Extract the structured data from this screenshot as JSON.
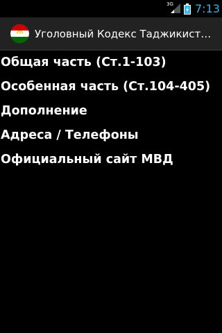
{
  "status_bar": {
    "network_type": "3G",
    "time": "7:13",
    "signal_icon": "signal-icon",
    "battery_icon": "battery-charging-icon",
    "clock_color": "#33b5e5"
  },
  "action_bar": {
    "app_icon": "tajikistan-flag-icon",
    "title": "Уголовный Кодекс Таджикистана"
  },
  "menu": {
    "items": [
      {
        "label": "Общая часть (Ст.1-103)"
      },
      {
        "label": "Особенная часть (Ст.104-405)"
      },
      {
        "label": "Дополнение"
      },
      {
        "label": "Адреса / Телефоны"
      },
      {
        "label": "Официальный сайт МВД"
      }
    ]
  }
}
